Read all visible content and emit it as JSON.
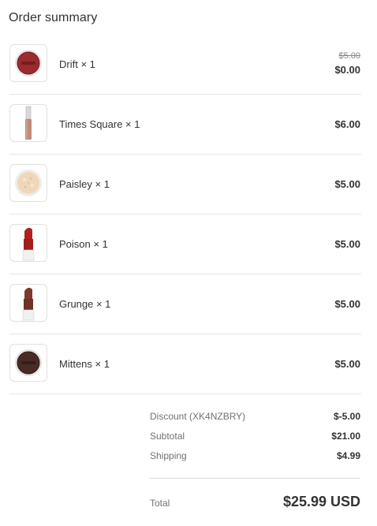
{
  "title": "Order summary",
  "items": [
    {
      "name": "Drift × 1",
      "old_price": "$5.00",
      "price": "$0.00",
      "thumb": "blush-compact",
      "swatch": "#9a2b2e"
    },
    {
      "name": "Times Square × 1",
      "price": "$6.00",
      "thumb": "lip-gloss-tube",
      "swatch": "#c08a7a"
    },
    {
      "name": "Paisley × 1",
      "price": "$5.00",
      "thumb": "shimmer-compact",
      "swatch": "#f0d7b8"
    },
    {
      "name": "Poison × 1",
      "price": "$5.00",
      "thumb": "lipstick",
      "swatch": "#b2211c"
    },
    {
      "name": "Grunge × 1",
      "price": "$5.00",
      "thumb": "lipstick",
      "swatch": "#7c3a2e"
    },
    {
      "name": "Mittens × 1",
      "price": "$5.00",
      "thumb": "blush-compact",
      "swatch": "#4a2a26"
    }
  ],
  "summary": {
    "discount_label": "Discount (XK4NZBRY)",
    "discount_value": "$-5.00",
    "subtotal_label": "Subtotal",
    "subtotal_value": "$21.00",
    "shipping_label": "Shipping",
    "shipping_value": "$4.99",
    "total_label": "Total",
    "total_value": "$25.99 USD"
  }
}
